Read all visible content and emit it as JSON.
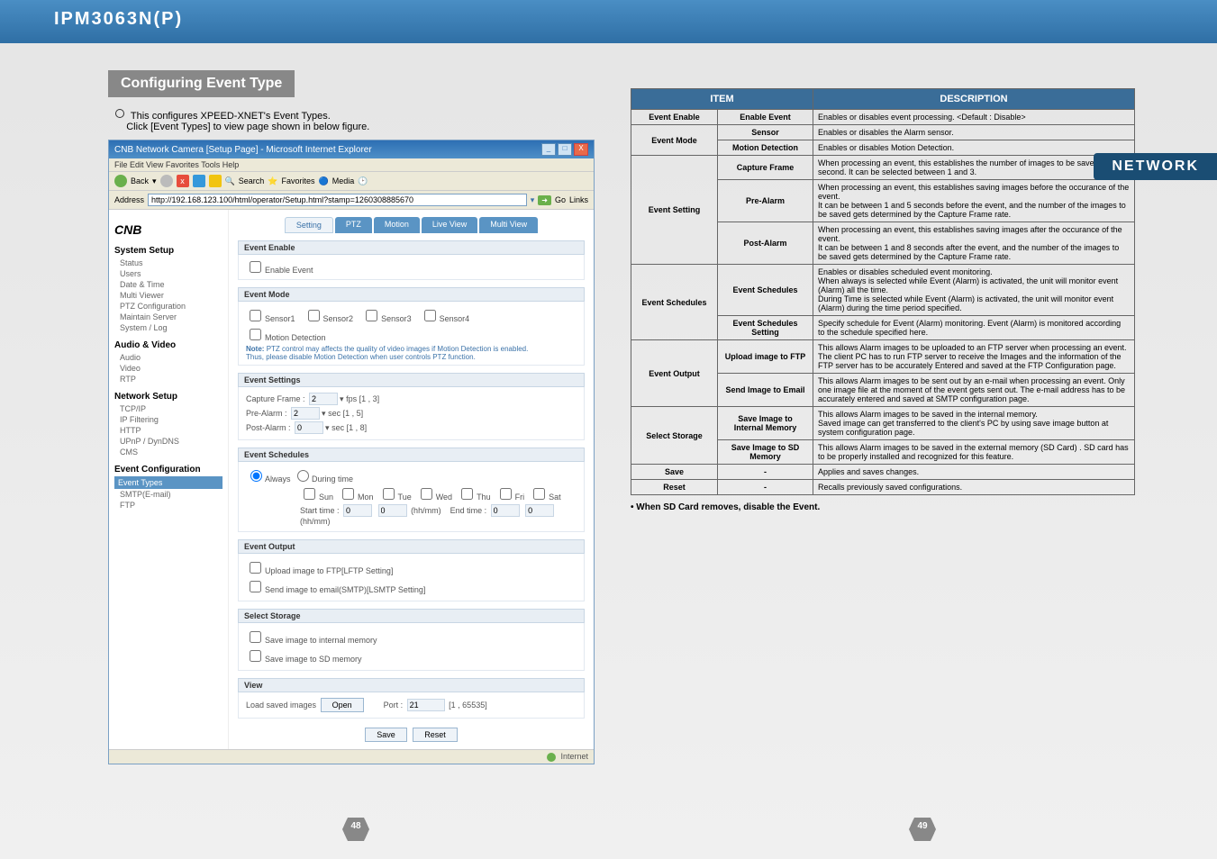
{
  "header": {
    "model": "IPM3063N(P)",
    "category": "NETWORK"
  },
  "section": {
    "title": "Configuring Event Type"
  },
  "intro": {
    "line1": "This configures XPEED-XNET's Event Types.",
    "line2": "Click  [Event Types] to view page shown in below figure."
  },
  "browser": {
    "title": "CNB Network Camera [Setup Page] - Microsoft Internet Explorer",
    "menu": "File   Edit   View   Favorites   Tools   Help",
    "toolbar": {
      "back": "Back",
      "search": "Search",
      "favorites": "Favorites",
      "media": "Media"
    },
    "address_label": "Address",
    "address_value": "http://192.168.123.100/html/operator/Setup.html?stamp=1260308885670",
    "go": "Go",
    "links": "Links",
    "status": "Internet",
    "logo": "CNB"
  },
  "sidebar": {
    "groups": [
      {
        "title": "System Setup",
        "items": [
          "Status",
          "Users",
          "Date & Time",
          "Multi Viewer",
          "PTZ Configuration",
          "Maintain Server",
          "System / Log"
        ]
      },
      {
        "title": "Audio & Video",
        "items": [
          "Audio",
          "Video",
          "RTP"
        ]
      },
      {
        "title": "Network Setup",
        "items": [
          "TCP/IP",
          "IP Filtering",
          "HTTP",
          "UPnP / DynDNS",
          "CMS"
        ]
      },
      {
        "title": "Event Configuration",
        "items": [
          "Event Types",
          "SMTP(E-mail)",
          "FTP"
        ],
        "active_index": 0
      }
    ]
  },
  "tabs": [
    "Setting",
    "PTZ",
    "Motion",
    "Live View",
    "Multi View"
  ],
  "panels": {
    "enable": {
      "head": "Event Enable",
      "cb": "Enable Event"
    },
    "mode": {
      "head": "Event Mode",
      "sensors": [
        "Sensor1",
        "Sensor2",
        "Sensor3",
        "Sensor4"
      ],
      "md": "Motion Detection",
      "note1": "Note:PTZ control may affects the quality of video images if Motion Detection is enabled.",
      "note2": "Thus, please disable Motion Detection when user controls PTZ function."
    },
    "settings": {
      "head": "Event Settings",
      "capture": "Capture Frame :",
      "capture_val": "2",
      "capture_range": "fps [1 , 3]",
      "pre": "Pre-Alarm :",
      "pre_val": "2",
      "pre_range": "sec [1 , 5]",
      "post": "Post-Alarm :",
      "post_val": "0",
      "post_range": "sec [1 , 8]"
    },
    "schedules": {
      "head": "Event Schedules",
      "always": "Always",
      "during": "During time",
      "days": [
        "Sun",
        "Mon",
        "Tue",
        "Wed",
        "Thu",
        "Fri",
        "Sat"
      ],
      "start": "Start time :",
      "end": "End time :",
      "val0": "0",
      "hhmm": "(hh/mm)"
    },
    "output": {
      "head": "Event Output",
      "ftp": "Upload image to FTP[LFTP Setting]",
      "smtp": "Send image to email(SMTP)[LSMTP Setting]"
    },
    "storage": {
      "head": "Select Storage",
      "internal": "Save image to internal memory",
      "sd": "Save image to SD memory"
    },
    "view": {
      "head": "View",
      "load": "Load saved images",
      "open": "Open",
      "port": "Port :",
      "port_val": "21",
      "port_range": "[1 , 65535]"
    },
    "buttons": {
      "save": "Save",
      "reset": "Reset"
    }
  },
  "table": {
    "head_item": "ITEM",
    "head_desc": "DESCRIPTION",
    "rows": [
      {
        "item": "Event Enable",
        "sub": "Enable Event",
        "desc": "Enables or disables event processing. <Default : Disable>"
      },
      {
        "item": "Event Mode",
        "sub": "Sensor",
        "desc": "Enables or disables the Alarm sensor."
      },
      {
        "item": "",
        "sub": "Motion Detection",
        "desc": "Enables or disables Motion Detection."
      },
      {
        "item": "Event Setting",
        "sub": "Capture Frame",
        "desc": "When processing an event, this establishes the number of images to be saved per second. It can be selected between 1 and 3."
      },
      {
        "item": "",
        "sub": "Pre-Alarm",
        "desc": "When processing an event, this establishes saving images before the occurance of the event.\nIt can be between 1 and 5 seconds before the event, and the number of the images to be saved gets determined by the Capture Frame rate."
      },
      {
        "item": "",
        "sub": "Post-Alarm",
        "desc": "When processing an event, this establishes saving images after the occurance of the event.\nIt can be between 1 and 8 seconds after the event, and the number of the images to be saved gets determined by the Capture Frame rate."
      },
      {
        "item": "Event Schedules",
        "sub": "Event Schedules",
        "desc": "Enables or disables scheduled event monitoring.\nWhen always is selected while Event (Alarm) is activated, the unit will monitor event (Alarm) all the time.\nDuring Time is selected while Event (Alarm) is activated, the unit will monitor event (Alarm) during the time period specified."
      },
      {
        "item": "",
        "sub": "Event Schedules Setting",
        "desc": "Specify schedule for Event (Alarm) monitoring. Event (Alarm) is monitored according to the schedule specified here."
      },
      {
        "item": "Event Output",
        "sub": "Upload image to FTP",
        "desc": "This allows Alarm images to be uploaded to an FTP server when processing an event. The client PC has to run FTP server to receive the Images and the information of the FTP server has to be accurately Entered and saved at the FTP Configuration page."
      },
      {
        "item": "",
        "sub": "Send Image to Email",
        "desc": "This allows Alarm images to be sent out by an e-mail when processing an event. Only one image file at the moment of the event gets sent out. The e-mail address has to be accurately entered and saved at SMTP configuration page."
      },
      {
        "item": "Select Storage",
        "sub": "Save Image to Internal Memory",
        "desc": "This allows Alarm images to be saved in the internal memory.\nSaved image can get transferred to the client's PC by using save image button at system configuration page."
      },
      {
        "item": "",
        "sub": "Save Image to SD Memory",
        "desc": "This allows Alarm images to be saved in the external memory (SD Card) . SD card has to be properly installed and recognized for this feature."
      },
      {
        "item": "Save",
        "sub": "-",
        "desc": "Applies and saves changes."
      },
      {
        "item": "Reset",
        "sub": "-",
        "desc": "Recalls previously saved configurations."
      }
    ]
  },
  "note_remove": "• When SD Card removes, disable the Event.",
  "page_numbers": {
    "left": "48",
    "right": "49"
  }
}
